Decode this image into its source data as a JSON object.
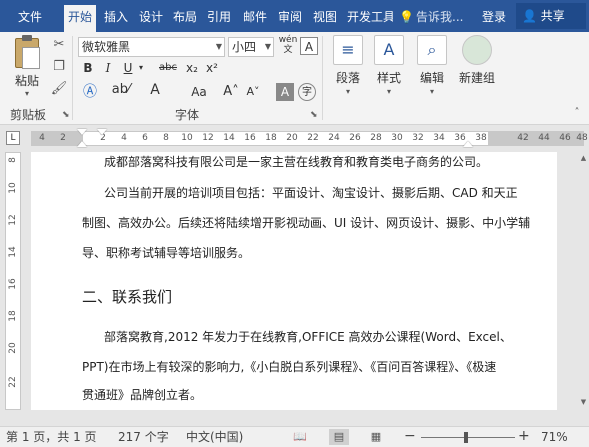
{
  "tabs": [
    {
      "label": "文件",
      "active": false
    },
    {
      "label": "开始",
      "active": true
    },
    {
      "label": "插入",
      "active": false
    },
    {
      "label": "设计",
      "active": false
    },
    {
      "label": "布局",
      "active": false
    },
    {
      "label": "引用",
      "active": false
    },
    {
      "label": "邮件",
      "active": false
    },
    {
      "label": "审阅",
      "active": false
    },
    {
      "label": "视图",
      "active": false
    },
    {
      "label": "开发工具",
      "active": false
    }
  ],
  "tell_me": "告诉我...",
  "login_label": "登录",
  "share_label": "共享",
  "ribbon": {
    "clipboard": {
      "paste_label": "粘贴",
      "group_label": "剪贴板"
    },
    "font": {
      "font_name": "微软雅黑",
      "font_size": "小四",
      "pinyin_label": "wén",
      "group_label": "字体",
      "highlight_color": "#ffff00",
      "font_color": "#d00000"
    },
    "paragraph_label": "段落",
    "styles_label": "样式",
    "editing_label": "编辑",
    "newgroup_label": "新建组"
  },
  "ruler": {
    "corner_label": "L",
    "numbers": [
      "4",
      "2",
      "2",
      "4",
      "6",
      "8",
      "10",
      "12",
      "14",
      "16",
      "18",
      "20",
      "22",
      "24",
      "26",
      "28",
      "30",
      "32",
      "34",
      "36",
      "38",
      "42",
      "44",
      "46",
      "48"
    ]
  },
  "vruler_numbers": [
    "8",
    "10",
    "12",
    "14",
    "16",
    "18",
    "20",
    "22"
  ],
  "document": {
    "lines": [
      "成都部落窝科技有限公司是一家主营在线教育和教育类电子商务的公司。",
      "公司当前开展的培训项目包括：平面设计、淘宝设计、摄影后期、CAD 和天正",
      "制图、高效办公。后续还将陆续增开影视动画、UI  设计、网页设计、摄影、中小学辅",
      "导、职称考试辅导等培训服务。"
    ],
    "heading": "二、联系我们",
    "lines2": [
      "部落窝教育,2012  年发力于在线教育,OFFICE  高效办公课程(Word、Excel、",
      "PPT)在市场上有较深的影响力,《小白脱白系列课程》、《百问百答课程》、《极速",
      "贯通班》品牌创立者。"
    ]
  },
  "status": {
    "page": "第 1 页，共 1 页",
    "words": "217 个字",
    "language": "中文(中国)",
    "zoom_minus": "−",
    "zoom_plus": "+",
    "zoom_level": "71%"
  }
}
